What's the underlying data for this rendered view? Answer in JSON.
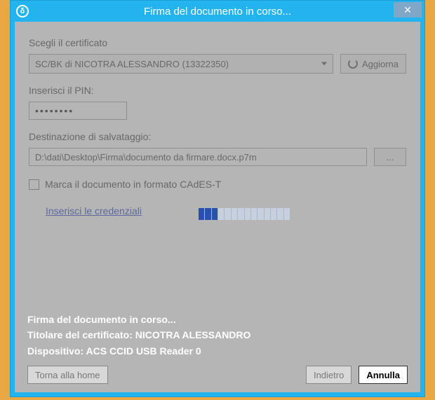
{
  "window": {
    "title": "Firma del documento in corso...",
    "app_icon_glyph": "δ"
  },
  "form": {
    "cert_label": "Scegli il certificato",
    "cert_value": "SC/BK di NICOTRA ALESSANDRO (13322350)",
    "refresh_label": "Aggiorna",
    "pin_label": "Inserisci il PIN:",
    "pin_value": "••••••••",
    "dest_label": "Destinazione di salvataggio:",
    "dest_value": "D:\\dati\\Desktop\\Firma\\documento da firmare.docx.p7m",
    "browse_label": "...",
    "mark_label": "Marca il documento in formato CAdES-T",
    "credentials_link": "Inserisci le credenziali"
  },
  "progress": {
    "segments_on": 3,
    "segments_total": 14
  },
  "status": {
    "line1": "Firma del documento in corso...",
    "line2_label": "Titolare del certificato: ",
    "line2_value": "NICOTRA ALESSANDRO",
    "line3_label": "Dispositivo: ",
    "line3_value": "ACS CCID USB Reader 0"
  },
  "buttons": {
    "home": "Torna alla home",
    "back": "Indietro",
    "cancel": "Annulla"
  }
}
